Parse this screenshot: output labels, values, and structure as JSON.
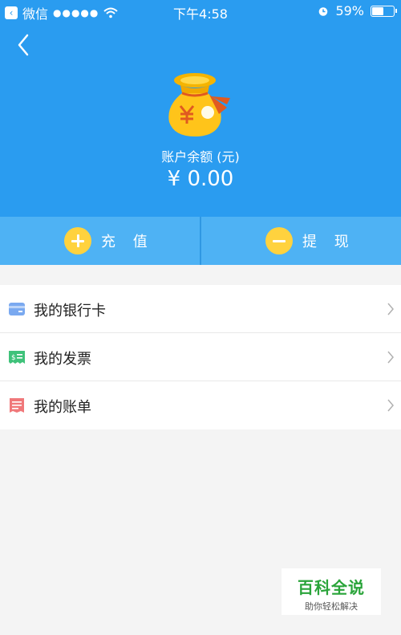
{
  "status_bar": {
    "carrier": "微信",
    "signal": "●●●●●",
    "time": "下午4:58",
    "battery_percent": "59%",
    "battery_level": 0.59
  },
  "header": {
    "balance_label": "账户余额 (元)",
    "balance_value": "¥ 0.00",
    "background_color": "#2a9cf0"
  },
  "actions": {
    "recharge_label": "充 值",
    "withdraw_label": "提 现"
  },
  "menu": {
    "items": [
      {
        "label": "我的银行卡",
        "icon": "bank-card-icon",
        "color": "#7aa9f0"
      },
      {
        "label": "我的发票",
        "icon": "invoice-icon",
        "color": "#3fc27a"
      },
      {
        "label": "我的账单",
        "icon": "bill-icon",
        "color": "#f0787a"
      }
    ]
  },
  "watermark": {
    "title": "百科全说",
    "subtitle": "助你轻松解决"
  },
  "colors": {
    "accent": "#2a9cf0",
    "action_bar": "#4eb2f4",
    "action_icon": "#ffd23e"
  }
}
